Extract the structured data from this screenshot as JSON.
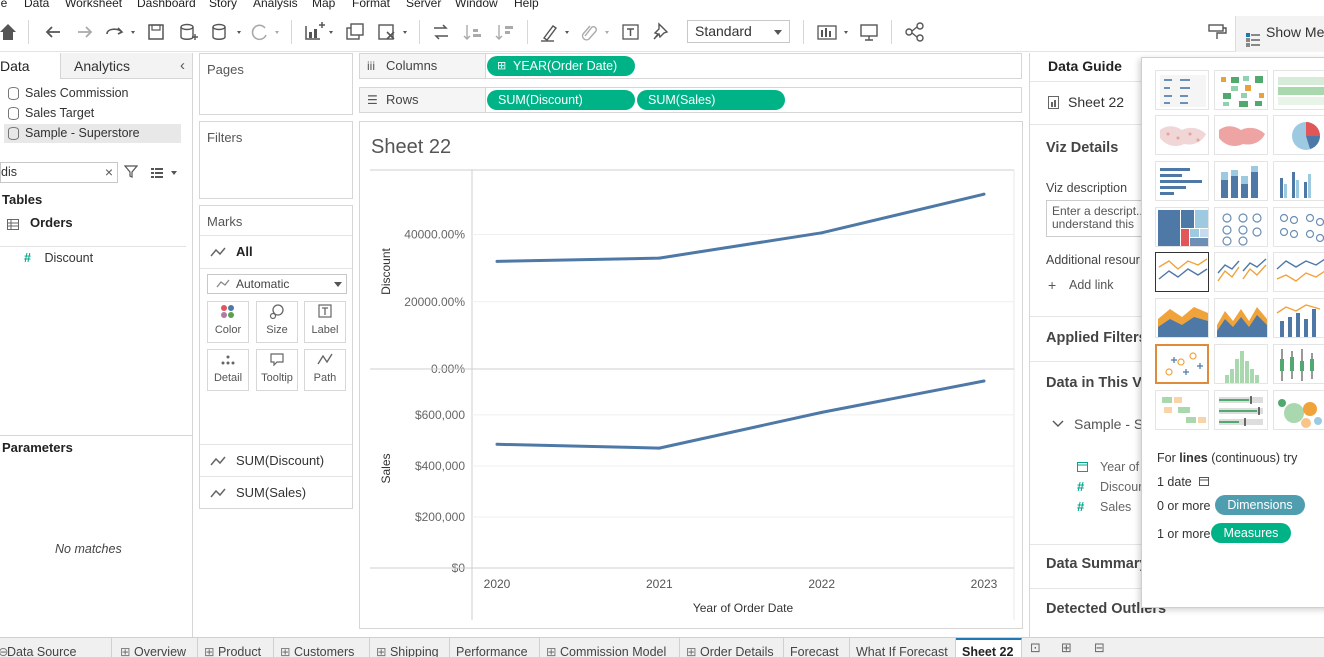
{
  "menu": [
    "le",
    "Data",
    "Worksheet",
    "Dashboard",
    "Story",
    "Analysis",
    "Map",
    "Format",
    "Server",
    "Window",
    "Help"
  ],
  "toolbar": {
    "fit_value": "Standard",
    "show_me_label": "Show Me"
  },
  "data_pane": {
    "tab_data": "Data",
    "tab_analytics": "Analytics",
    "data_sources": [
      "Sales Commission",
      "Sales Target",
      "Sample - Superstore"
    ],
    "search_value": "dis",
    "tables_header": "Tables",
    "table_name": "Orders",
    "fields": [
      "Discount"
    ],
    "parameters_header": "Parameters",
    "no_matches": "No matches"
  },
  "cards": {
    "pages": "Pages",
    "filters": "Filters",
    "marks": "Marks",
    "marks_all": "All",
    "mark_type": "Automatic",
    "mark_buttons": [
      "Color",
      "Size",
      "Label",
      "Detail",
      "Tooltip",
      "Path"
    ],
    "mark_fields": [
      "SUM(Discount)",
      "SUM(Sales)"
    ]
  },
  "shelves": {
    "columns_label": "Columns",
    "rows_label": "Rows",
    "columns_pills": [
      "YEAR(Order Date)"
    ],
    "rows_pills": [
      "SUM(Discount)",
      "SUM(Sales)"
    ]
  },
  "sheet_title": "Sheet 22",
  "chart_data": [
    {
      "type": "line",
      "x": [
        "2020",
        "2021",
        "2022",
        "2023"
      ],
      "ylabel": "Discount",
      "yticks": [
        "0.00%",
        "20000.00%",
        "40000.00%"
      ],
      "series": [
        {
          "values": [
            32000,
            33000,
            40500,
            52000
          ]
        }
      ],
      "ylim": [
        0,
        58000
      ],
      "color": "#4e79a7"
    },
    {
      "type": "line",
      "x": [
        "2020",
        "2021",
        "2022",
        "2023"
      ],
      "xlabel": "Year of Order Date",
      "ylabel": "Sales",
      "yticks": [
        "$0",
        "$200,000",
        "$400,000",
        "$600,000"
      ],
      "series": [
        {
          "values": [
            485000,
            470000,
            610000,
            733000
          ]
        }
      ],
      "ylim": [
        0,
        780000
      ],
      "color": "#4e79a7"
    }
  ],
  "data_guide": {
    "title": "Data Guide",
    "sheet_name": "Sheet 22",
    "viz_details": "Viz Details",
    "viz_description_label": "Viz description",
    "viz_description_placeholder": "Enter a descript... understand this",
    "additional_resources": "Additional resour",
    "add_link": "Add link",
    "applied_filters": "Applied Filters",
    "data_in_viz": "Data in This Vi",
    "source_name": "Sample - S",
    "fields": [
      "Year of O",
      "Discour",
      "Sales"
    ],
    "data_summary": "Data Summary",
    "detected_outliers": "Detected Outliers"
  },
  "show_me": {
    "hint_prefix": "For",
    "hint_bold": "lines",
    "hint_suffix": "(continuous) try",
    "req_date": "1 date",
    "req_dims_prefix": "0 or more",
    "dims_label": "Dimensions",
    "req_meas_prefix": "1 or more",
    "meas_label": "Measures",
    "dims_color": "#4f9eb0",
    "meas_color": "#00b386"
  },
  "sheet_tabs": [
    "Data Source",
    "Overview",
    "Product",
    "Customers",
    "Shipping",
    "Performance",
    "Commission Model",
    "Order Details",
    "Forecast",
    "What If Forecast",
    "Sheet 22"
  ]
}
